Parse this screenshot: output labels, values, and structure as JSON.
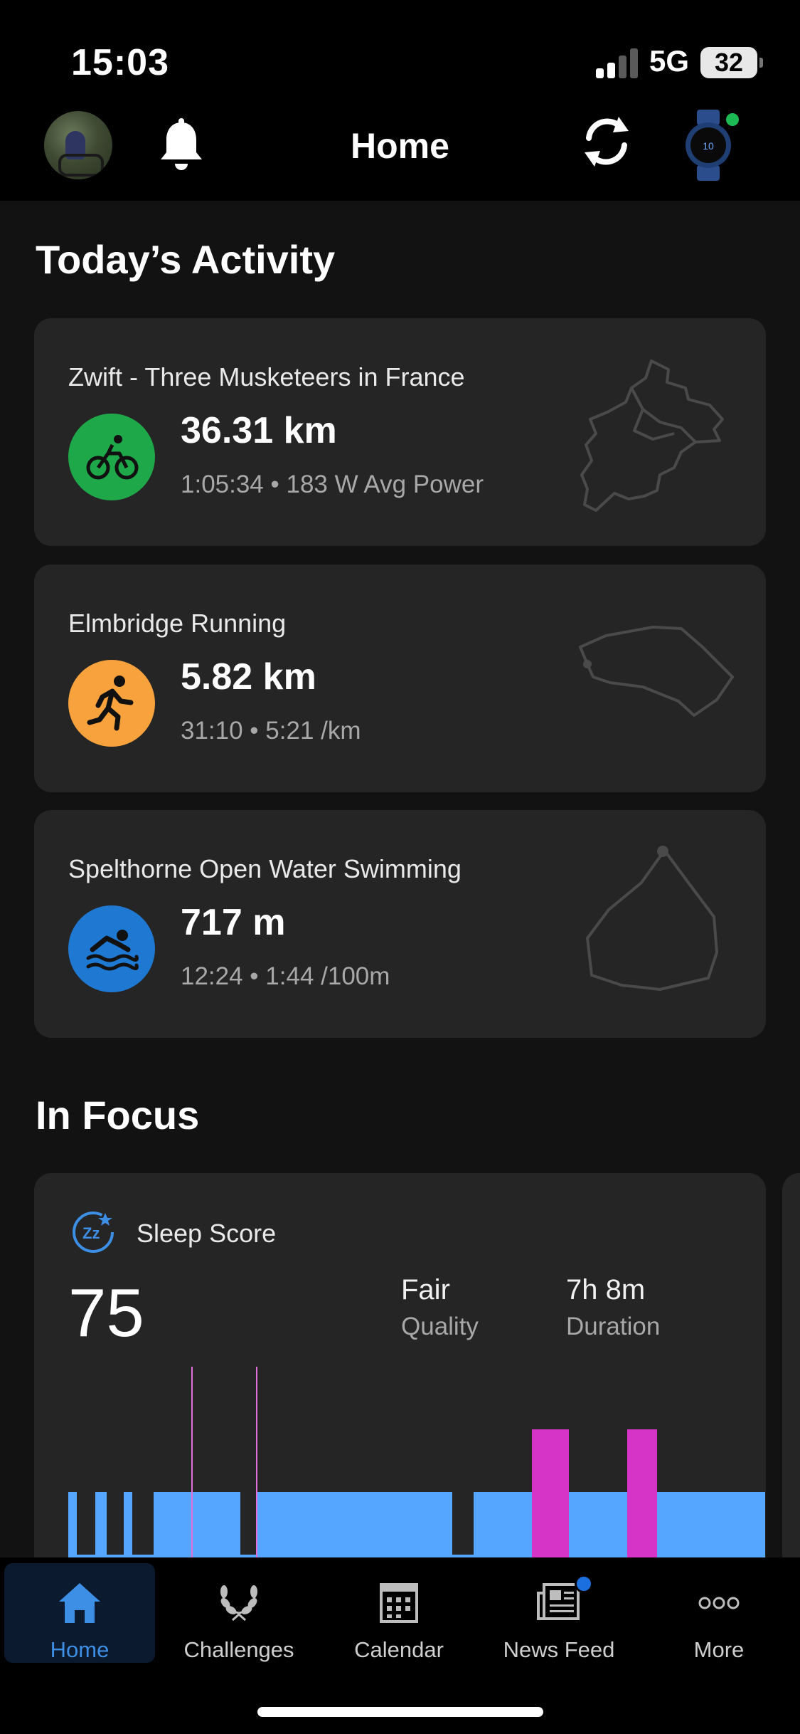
{
  "status_bar": {
    "time": "15:03",
    "network": "5G",
    "battery": "32"
  },
  "header": {
    "title": "Home",
    "icons": [
      "avatar",
      "bell-icon",
      "sync-icon",
      "watch-icon"
    ]
  },
  "today": {
    "title": "Today’s Activity",
    "activities": [
      {
        "name": "Zwift - Three Musketeers in France",
        "main": "36.31 km",
        "sub": "1:05:34 • 183 W Avg Power",
        "icon": "cycling-icon",
        "color": "#1fa84a"
      },
      {
        "name": "Elmbridge Running",
        "main": "5.82 km",
        "sub": "31:10 • 5:21 /km",
        "icon": "running-icon",
        "color": "#f7a23c"
      },
      {
        "name": "Spelthorne Open Water Swimming",
        "main": "717 m",
        "sub": "12:24 • 1:44 /100m",
        "icon": "swimming-icon",
        "color": "#1f78d1"
      }
    ]
  },
  "focus": {
    "title": "In Focus",
    "sleep": {
      "label": "Sleep Score",
      "score": "75",
      "quality_value": "Fair",
      "quality_label": "Quality",
      "duration_value": "7h 8m",
      "duration_label": "Duration"
    }
  },
  "colors": {
    "awake": "#d633c7",
    "light": "#55a6ff",
    "background": "#121212",
    "card": "#252525",
    "accent": "#3d8fe6"
  },
  "tabs": [
    {
      "label": "Home",
      "icon": "home-icon",
      "active": true
    },
    {
      "label": "Challenges",
      "icon": "laurel-icon",
      "active": false
    },
    {
      "label": "Calendar",
      "icon": "calendar-icon",
      "active": false
    },
    {
      "label": "News Feed",
      "icon": "newspaper-icon",
      "active": false,
      "badge": true
    },
    {
      "label": "More",
      "icon": "more-icon",
      "active": false
    }
  ]
}
